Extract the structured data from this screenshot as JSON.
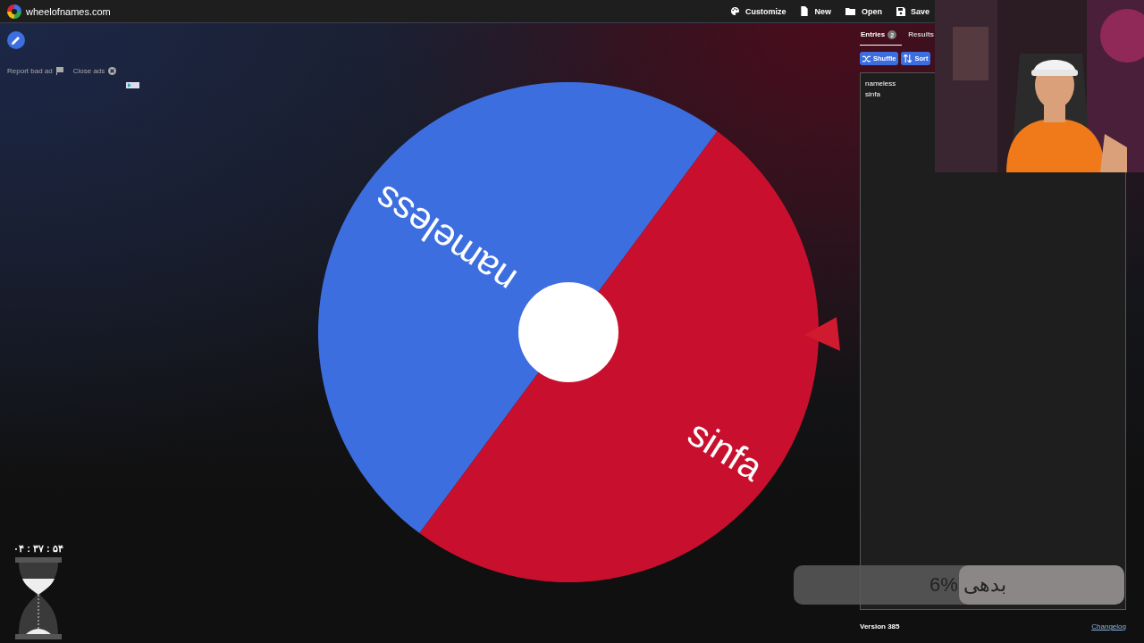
{
  "site": {
    "title": "wheelofnames.com"
  },
  "top_menu": [
    {
      "label": "Customize",
      "kind": "palette"
    },
    {
      "label": "New",
      "kind": "file"
    },
    {
      "label": "Open",
      "kind": "folder"
    },
    {
      "label": "Save",
      "kind": "disk"
    }
  ],
  "ad_controls": [
    {
      "label": "Report bad ad",
      "kind": "flag"
    },
    {
      "label": "Close ads",
      "kind": "close"
    }
  ],
  "wheel": {
    "slices": [
      {
        "label": "nameless",
        "color": "#3d6ee0"
      },
      {
        "label": "sinfa",
        "color": "#c8102e"
      }
    ]
  },
  "panel": {
    "tabs": [
      {
        "label": "Entries",
        "badge": "2",
        "selected": true
      },
      {
        "label": "Results",
        "selected": false
      }
    ],
    "buttons": [
      {
        "label": "Shuffle",
        "kind": "shuffle"
      },
      {
        "label": "Sort",
        "kind": "sort"
      }
    ],
    "entries": [
      "nameless",
      "sinfa"
    ],
    "version": "Version 385",
    "changelog": "Changelog"
  },
  "timer": {
    "text": "۰۴ : ۳۷ : ۵۴"
  },
  "progress": {
    "label": "6% بدهی",
    "level": 0.5
  }
}
